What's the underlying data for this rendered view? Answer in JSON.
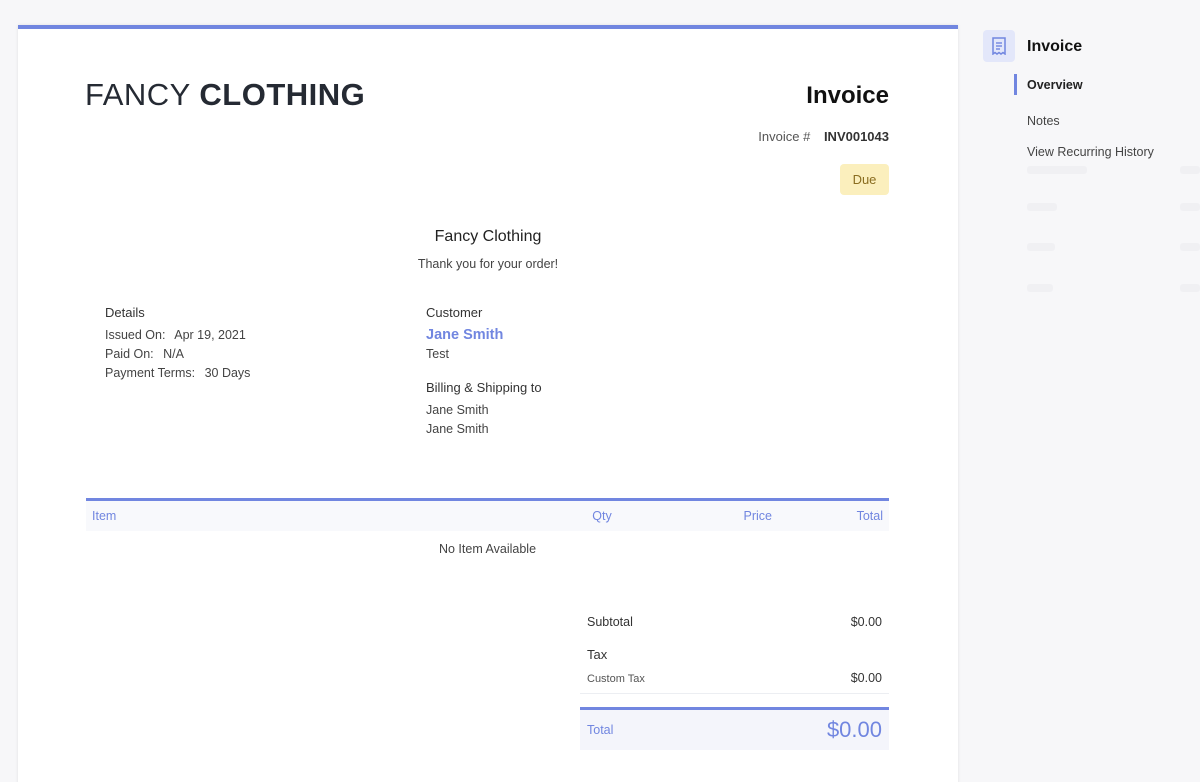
{
  "invoice_card": {
    "logo_light": "FANCY",
    "logo_bold": "CLOTHING",
    "title": "Invoice",
    "invoice_number_label": "Invoice #",
    "invoice_number": "INV001043",
    "status": "Due",
    "status_color": "#fbefbd",
    "company_name": "Fancy Clothing",
    "thank_you": "Thank you for your order!"
  },
  "details": {
    "heading": "Details",
    "issued_on_label": "Issued On:",
    "issued_on": "Apr 19, 2021",
    "paid_on_label": "Paid On:",
    "paid_on": "N/A",
    "payment_terms_label": "Payment Terms:",
    "payment_terms": "30 Days"
  },
  "customer": {
    "heading": "Customer",
    "name": "Jane Smith",
    "note": "Test",
    "billing_heading": "Billing & Shipping to",
    "billing_line1": "Jane Smith",
    "billing_line2": "Jane Smith"
  },
  "items_table": {
    "columns": [
      "Item",
      "Qty",
      "Price",
      "Total"
    ],
    "empty_message": "No Item Available"
  },
  "totals": {
    "subtotal_label": "Subtotal",
    "subtotal": "$0.00",
    "tax_label": "Tax",
    "custom_tax_label": "Custom Tax",
    "custom_tax": "$0.00",
    "total_label": "Total",
    "total": "$0.00"
  },
  "sidebar": {
    "title": "Invoice",
    "icon": "receipt-icon",
    "items": [
      {
        "label": "Overview",
        "active": true
      },
      {
        "label": "Notes",
        "active": false
      },
      {
        "label": "View Recurring History",
        "active": false
      }
    ]
  },
  "colors": {
    "accent": "#7186e0",
    "badge_bg": "#fbefbd",
    "badge_text": "#8a6d20"
  }
}
